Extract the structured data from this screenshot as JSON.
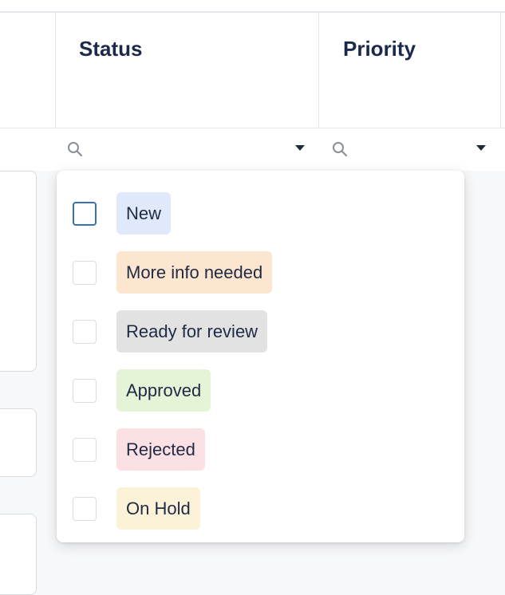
{
  "columns": {
    "status": {
      "header": "Status"
    },
    "priority": {
      "header": "Priority"
    }
  },
  "filter": {
    "search_icon": "search-icon",
    "dropdown_icon": "caret-down-icon"
  },
  "status_options": [
    {
      "label": "New",
      "checked": false,
      "focused": true,
      "color": "#dfe9fb"
    },
    {
      "label": "More info needed",
      "checked": false,
      "focused": false,
      "color": "#fde6cf"
    },
    {
      "label": "Ready for review",
      "checked": false,
      "focused": false,
      "color": "#e2e2e2"
    },
    {
      "label": "Approved",
      "checked": false,
      "focused": false,
      "color": "#e5f4d7"
    },
    {
      "label": "Rejected",
      "checked": false,
      "focused": false,
      "color": "#fbe0e4"
    },
    {
      "label": "On Hold",
      "checked": false,
      "focused": false,
      "color": "#fbf2d8"
    }
  ]
}
